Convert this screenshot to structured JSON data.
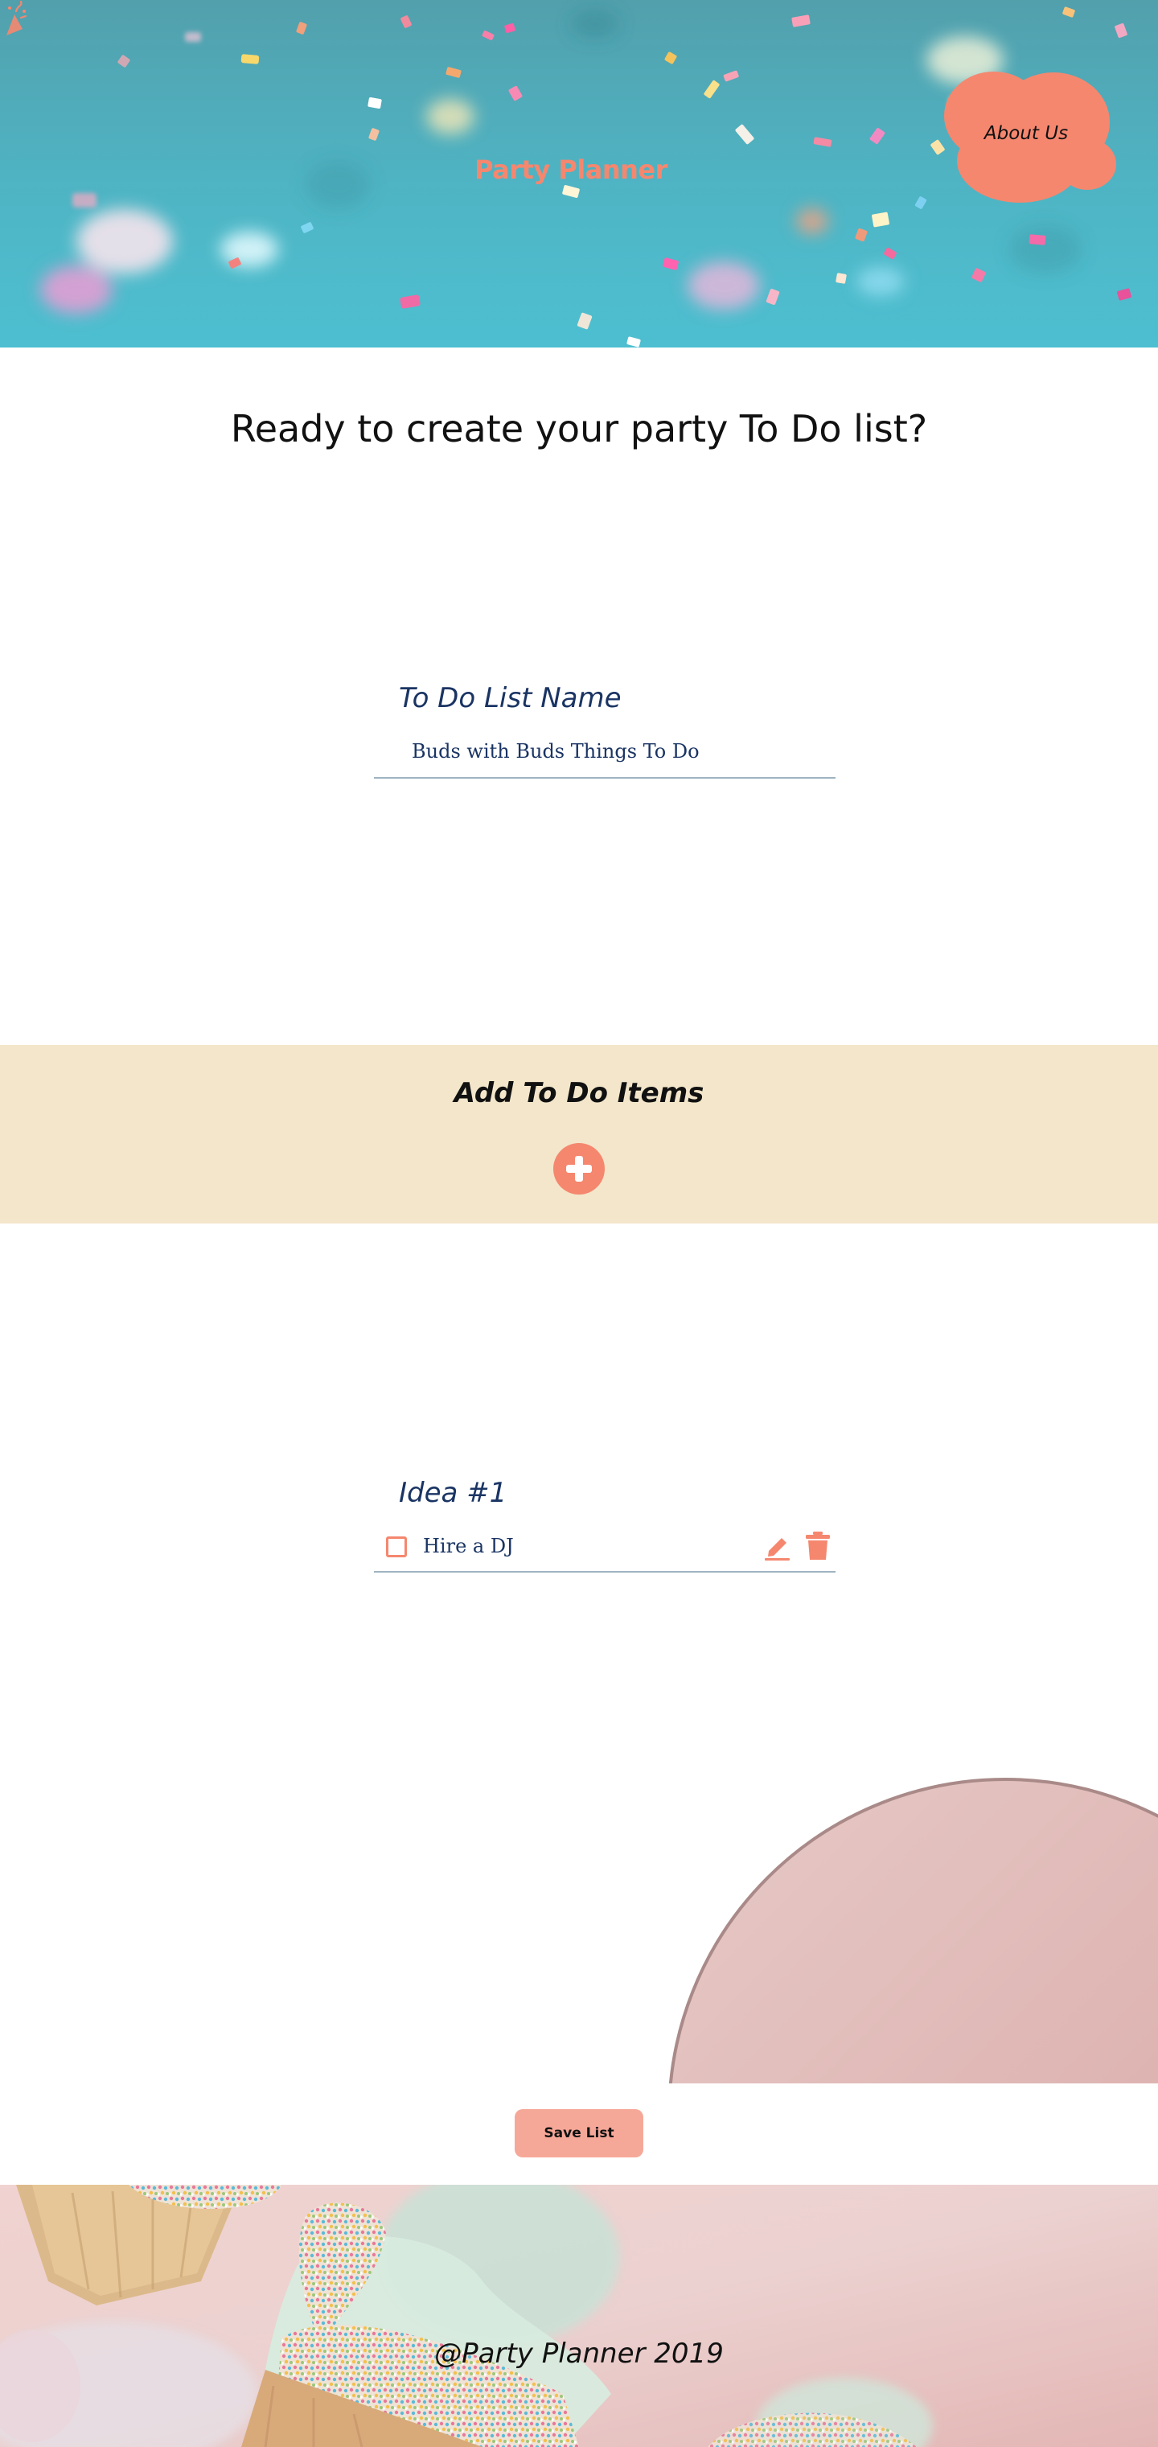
{
  "header": {
    "brand": "Party Planner",
    "about_label": "About Us",
    "icons": {
      "brand": "party-popper-icon"
    },
    "colors": {
      "background": "#4fb6c6",
      "accent": "#f5876f"
    }
  },
  "main": {
    "title": "Ready to create your party To Do list?",
    "list_name": {
      "label": "To Do List Name",
      "value": "Buds with Buds Things To Do"
    }
  },
  "add_items": {
    "title": "Add To Do Items",
    "icons": {
      "add": "plus-circle-icon"
    },
    "colors": {
      "background": "#f3e6ca"
    }
  },
  "ideas": [
    {
      "label": "Idea #1",
      "text": "Hire a DJ",
      "checked": false,
      "icons": {
        "edit": "pencil-icon",
        "delete": "trash-icon",
        "check": "checkbox-icon"
      }
    }
  ],
  "actions": {
    "save_label": "Save List",
    "colors": {
      "save": "#f6a898"
    }
  },
  "footer": {
    "text": "@Party Planner 2019"
  }
}
